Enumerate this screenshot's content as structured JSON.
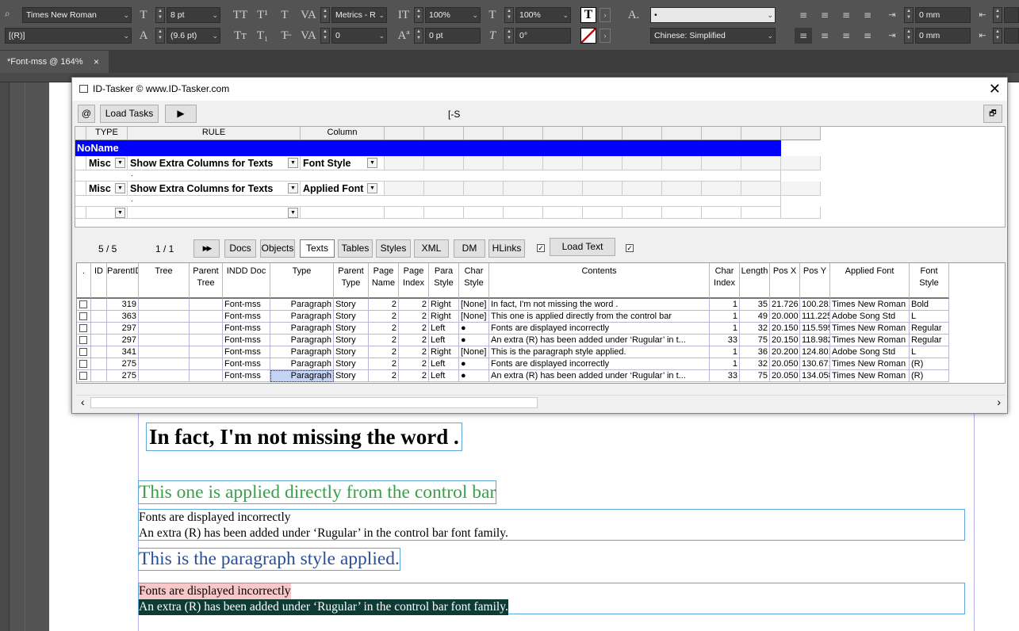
{
  "control_bar": {
    "font_family": "Times New Roman",
    "font_style": "[(R)]",
    "font_size": "8 pt",
    "leading": "(9.6 pt)",
    "kerning": "Metrics - R",
    "tracking": "0",
    "vscale": "100%",
    "hscale": "100%",
    "baseline": "0 pt",
    "skew": "0°",
    "bullet_field": "•",
    "language": "Chinese: Simplified",
    "indent1": "0 mm",
    "indent2": "0 mm"
  },
  "doc_tab": {
    "label": "*Font-mss @ 164%",
    "close": "×"
  },
  "canvas": {
    "line1": "In fact, I'm not missing the word .",
    "line2": "This one is applied directly from the control bar",
    "line3": "Fonts are displayed incorrectly",
    "line4": "An extra (R) has been added under ‘Rugular’ in the control bar font family.",
    "line5": "This is the paragraph style applied.",
    "line6": "Fonts are displayed incorrectly",
    "line7": "An extra (R) has been added under ‘Rugular’ in the control bar font family."
  },
  "window": {
    "title": "ID-Tasker  © www.ID-Tasker.com",
    "close": "✕",
    "at": "@",
    "load_tasks": "Load Tasks",
    "play": "▶",
    "center_label": "[-S",
    "restore": "🗗",
    "rules_header": {
      "type": "TYPE",
      "rule": "RULE",
      "column": "Column"
    },
    "group_name": "NoName",
    "rules": [
      {
        "type": "Misc",
        "rule": "Show Extra Columns for Texts",
        "column": "Font Style",
        "sub": "."
      },
      {
        "type": "Misc",
        "rule": "Show Extra Columns for Texts",
        "column": "Applied Font",
        "sub": "."
      }
    ],
    "nav": {
      "count1": "5 / 5",
      "count2": "1 / 1",
      "ff": "▶▶",
      "docs": "Docs",
      "objects": "Objects",
      "texts": "Texts",
      "tables": "Tables",
      "styles": "Styles",
      "xml": "XML",
      "dm": "DM",
      "hlinks": "HLinks",
      "load_text": "Load Text"
    },
    "columns": [
      ".",
      "ID",
      "ParentID",
      "Tree",
      "Parent Tree",
      "INDD Doc",
      "Type",
      "Parent Type",
      "Page Name",
      "Page Index",
      "Para Style",
      "Char Style",
      "Contents",
      "Char Index",
      "Length",
      "Pos X",
      "Pos Y",
      "Applied Font",
      "Font Style"
    ],
    "rows": [
      [
        "",
        "",
        "319",
        "",
        "",
        "Font-mss",
        "Paragraph",
        "Story",
        "2",
        "2",
        "Right",
        "[None]",
        "In fact, I'm not missing the word .",
        "1",
        "35",
        "21.726",
        "100.281",
        "Times New Roman",
        "Bold"
      ],
      [
        "",
        "",
        "363",
        "",
        "",
        "Font-mss",
        "Paragraph",
        "Story",
        "2",
        "2",
        "Right",
        "[None]",
        "This one is applied directly from the control bar",
        "1",
        "49",
        "20.000",
        "111.225",
        "Adobe Song Std",
        "L"
      ],
      [
        "",
        "",
        "297",
        "",
        "",
        "Font-mss",
        "Paragraph",
        "Story",
        "2",
        "2",
        "Left",
        "●",
        "Fonts are displayed incorrectly",
        "1",
        "32",
        "20.150",
        "115.595",
        "Times New Roman",
        "Regular"
      ],
      [
        "",
        "",
        "297",
        "",
        "",
        "Font-mss",
        "Paragraph",
        "Story",
        "2",
        "2",
        "Left",
        "●",
        "An extra (R) has been added under ‘Rugular’ in t...",
        "33",
        "75",
        "20.150",
        "118.982",
        "Times New Roman",
        "Regular"
      ],
      [
        "",
        "",
        "341",
        "",
        "",
        "Font-mss",
        "Paragraph",
        "Story",
        "2",
        "2",
        "Right",
        "[None]",
        "This is the paragraph style applied.",
        "1",
        "36",
        "20.200",
        "124.801",
        "Adobe Song Std",
        "L"
      ],
      [
        "",
        "",
        "275",
        "",
        "",
        "Font-mss",
        "Paragraph",
        "Story",
        "2",
        "2",
        "Left",
        "●",
        "Fonts are displayed incorrectly",
        "1",
        "32",
        "20.050",
        "130.671",
        "Times New Roman",
        "(R)"
      ],
      [
        "",
        "",
        "275",
        "",
        "",
        "Font-mss",
        "Paragraph",
        "Story",
        "2",
        "2",
        "Left",
        "●",
        "An extra (R) has been added under ‘Rugular’ in t...",
        "33",
        "75",
        "20.050",
        "134.058",
        "Times New Roman",
        "(R)"
      ]
    ],
    "scroll_left": "‹",
    "scroll_right": "›"
  }
}
